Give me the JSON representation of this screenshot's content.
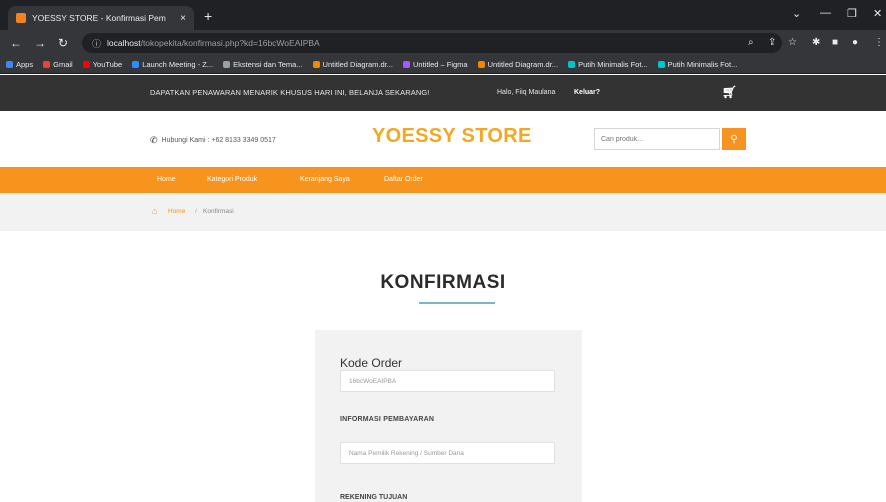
{
  "browser": {
    "tab_title": "YOESSY STORE - Konfirmasi Pem",
    "tab_close": "×",
    "new_tab": "+",
    "url_host": "localhost",
    "url_path": "/tokopekita/konfirmasi.php?kd=16bcWoEAIPBA",
    "bookmarks": [
      {
        "label": "Apps",
        "color": "#4285f4"
      },
      {
        "label": "Gmail",
        "color": "#ea4335"
      },
      {
        "label": "YouTube",
        "color": "#ff0000"
      },
      {
        "label": "Launch Meeting - Z...",
        "color": "#2d8cff"
      },
      {
        "label": "Ekstensi dan Tema...",
        "color": "#9aa0a6"
      },
      {
        "label": "Untitled Diagram.dr...",
        "color": "#f08705"
      },
      {
        "label": "Untitled – Figma",
        "color": "#a259ff"
      },
      {
        "label": "Untitled Diagram.dr...",
        "color": "#f08705"
      },
      {
        "label": "Putih Minimalis Fot...",
        "color": "#00c4cc"
      },
      {
        "label": "Putih Minimalis Fot...",
        "color": "#00c4cc"
      }
    ]
  },
  "promo": {
    "message": "DAPATKAN PENAWARAN MENARIK KHUSUS HARI INI, BELANJA SEKARANG!",
    "greeting": "Halo, Fiiq Maulana",
    "logout": "Keluar?",
    "cart_icon": "cart-icon"
  },
  "header": {
    "phone_text": "Hubungi Kami : +62 8133 3349 0517",
    "brand": "YOESSY STORE",
    "search_placeholder": "Cari produk...",
    "brand_color": "#f5a623",
    "accent_color": "#f7941d"
  },
  "nav": {
    "items": [
      "Home",
      "Kategori Produk",
      "Keranjang Saya",
      "Daftar Order"
    ]
  },
  "breadcrumb": {
    "home": "Home",
    "separator": "/",
    "current": "Konfirmasi"
  },
  "page": {
    "title": "KONFIRMASI"
  },
  "form": {
    "order_label": "Kode Order",
    "order_value": "16bcWoEAIPBA",
    "payment_section": "INFORMASI PEMBAYARAN",
    "account_placeholder": "Nama Pemilik Rekening / Sumber Dana",
    "next_section": "REKENING TUJUAN"
  }
}
